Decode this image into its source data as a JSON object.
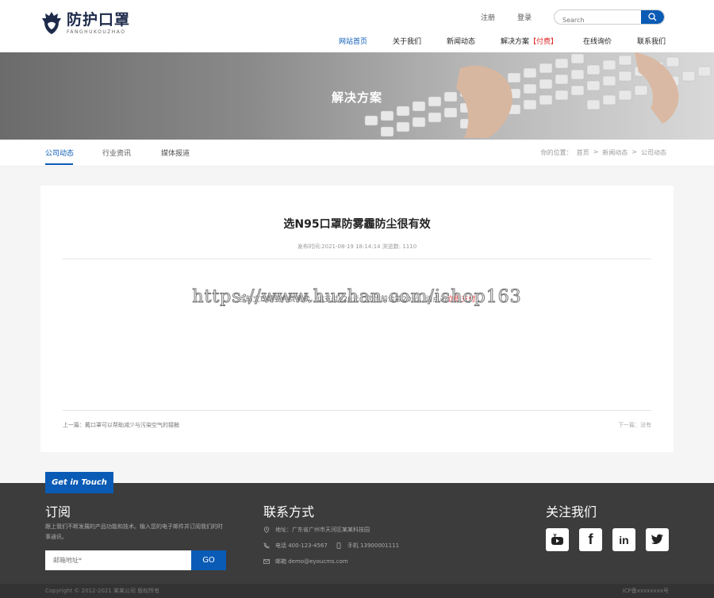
{
  "header": {
    "logo_cn": "防护口罩",
    "logo_en": "FANGHUKOUZHAO",
    "top_links": [
      "注册",
      "登录"
    ],
    "search_placeholder": "Search",
    "nav": [
      "网站首页",
      "关于我们",
      "新闻动态",
      "解决方案",
      "【付费】",
      "在线询价",
      "联系我们"
    ]
  },
  "banner": {
    "title": "解决方案"
  },
  "subnav": {
    "tabs": [
      "公司动态",
      "行业资讯",
      "媒体报道"
    ],
    "breadcrumb": [
      "你的位置：",
      "首页",
      ">",
      "新闻动态",
      ">",
      "公司动态"
    ]
  },
  "article": {
    "title": "选N95口罩防雾霾防尘很有效",
    "meta": "发布时间:2021-08-19 18:14:14   浏览数: 1110",
    "body_prefix": "当前文章需要付费阅读，请支付¥20元，您当前余额20元，请点击",
    "body_pay": "立即支付",
    "watermark": "https://www.huzhan.com/ishop163",
    "prev": "上一篇：戴口罩可以帮助减少与污染空气的接触",
    "next": "下一篇：没有"
  },
  "footer": {
    "touch_label": "Get in Touch",
    "subscribe_title": "订阅",
    "subscribe_text": "跟上我们不断发展的产品功能和技术。输入您的电子邮件并订阅我们的时事通讯。",
    "email_placeholder": "邮箱地址*",
    "go_label": "GO",
    "contact_title": "联系方式",
    "address": "地址：广东省广州市天河区某某科技园",
    "phone": "电话 400-123-4567",
    "mobile": "手机 13900001111",
    "email": "邮箱 demo@eyoucms.com",
    "follow_title": "关注我们",
    "copyright": "Copyright © 2012-2021 某某公司 版权所有",
    "icp": "ICP备xxxxxxxx号"
  },
  "colors": {
    "brand": "#0a5bb5",
    "paid": "#e02b2b",
    "footer": "#3c3c3c"
  }
}
